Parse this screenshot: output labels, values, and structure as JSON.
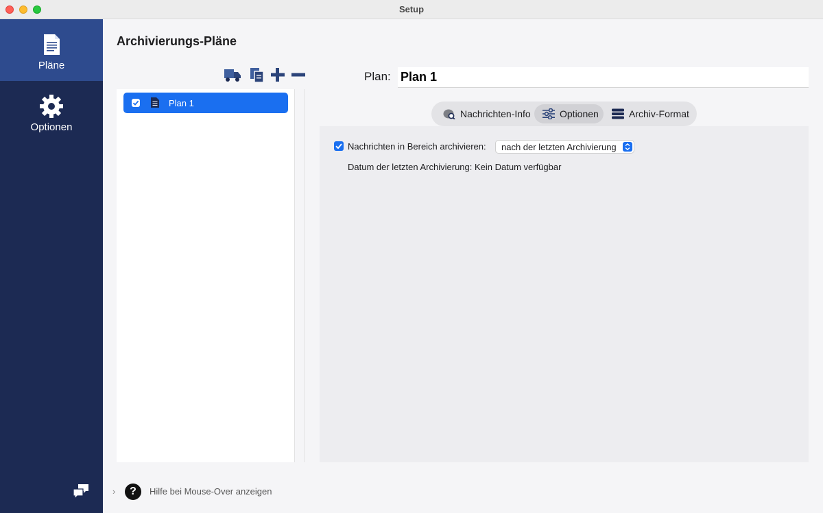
{
  "window": {
    "title": "Setup"
  },
  "sidebar": {
    "items": [
      {
        "label": "Pläne",
        "icon": "document-icon"
      },
      {
        "label": "Optionen",
        "icon": "gear-icon"
      }
    ],
    "chat_icon": "chat-bubbles-icon"
  },
  "main": {
    "title": "Archivierungs-Pläne",
    "toolbar": {
      "icons": [
        "truck-icon",
        "duplicate-icon",
        "plus-icon",
        "minus-icon"
      ]
    },
    "plans": [
      {
        "name": "Plan 1",
        "checked": true
      }
    ],
    "plan_label": "Plan:",
    "plan_name": "Plan 1",
    "tabs": [
      {
        "label": "Nachrichten-Info",
        "icon": "message-search-icon"
      },
      {
        "label": "Optionen",
        "icon": "sliders-icon",
        "selected": true
      },
      {
        "label": "Archiv-Format",
        "icon": "database-icon"
      }
    ],
    "options": {
      "archive_range_label": "Nachrichten in Bereich archivieren:",
      "archive_range_checked": true,
      "archive_range_value": "nach der letzten Archivierung",
      "last_archive_text": "Datum der letzten Archivierung: Kein Datum verfügbar"
    }
  },
  "footer": {
    "help_text": "Hilfe bei Mouse-Over anzeigen",
    "chevron": "›",
    "help_glyph": "?"
  },
  "colors": {
    "sidebar": "#1c2a53",
    "sidebar_active": "#2e4b8e",
    "accent": "#1a6ff0"
  }
}
